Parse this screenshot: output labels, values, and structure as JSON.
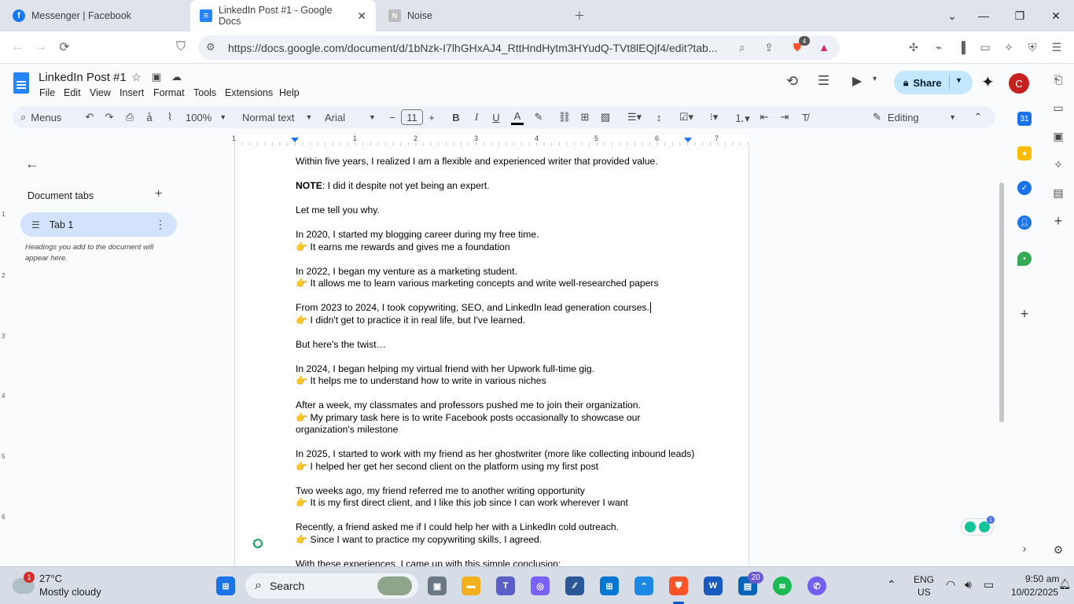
{
  "browser": {
    "tabs": [
      {
        "title": "Messenger | Facebook"
      },
      {
        "title": "LinkedIn Post #1 - Google Docs"
      },
      {
        "title": "Noise"
      }
    ],
    "url": "https://docs.google.com/document/d/1bNzk-I7lhGHxAJ4_RttHndHytm3HYudQ-TVt8lEQjf4/edit?tab...",
    "brave_badge": "4"
  },
  "docs": {
    "title": "LinkedIn Post #1",
    "menus": [
      "File",
      "Edit",
      "View",
      "Insert",
      "Format",
      "Tools",
      "Extensions",
      "Help"
    ],
    "share_label": "Share",
    "avatar_letter": "C",
    "toolbar": {
      "menus_label": "Menus",
      "zoom": "100%",
      "style": "Normal text",
      "font": "Arial",
      "font_size": "11",
      "mode": "Editing"
    },
    "ruler_marks": [
      "1",
      "1",
      "2",
      "3",
      "4",
      "5",
      "6",
      "7"
    ],
    "vruler_marks": [
      "1",
      "2",
      "3",
      "4",
      "5",
      "6"
    ],
    "sidepanel": {
      "heading": "Document tabs",
      "tab_label": "Tab 1",
      "hint": "Headings you add to the document will appear here."
    },
    "grammarly_badge": "1",
    "content": [
      {
        "lines": [
          "Within five years, I realized I am a flexible and experienced writer that provided value."
        ]
      },
      {
        "bold": "NOTE",
        "rest": ": I did it despite not yet being an expert."
      },
      {
        "lines": [
          "Let me tell you why."
        ]
      },
      {
        "lines": [
          "In 2020, I started my blogging career during my free time.",
          "👉 It earns me rewards and gives me a foundation"
        ]
      },
      {
        "lines": [
          "In 2022, I began my venture as a marketing student.",
          "👉 It allows me to learn various marketing concepts and write well-researched papers"
        ]
      },
      {
        "lines": [
          "From 2023 to 2024, I took copywriting, SEO, and LinkedIn lead generation courses.",
          "👉 I didn't get to practice it in real life, but I've learned."
        ]
      },
      {
        "lines": [
          "But here's the twist…"
        ]
      },
      {
        "lines": [
          "In 2024, I began helping my virtual friend with her Upwork full-time gig.",
          "👉 It helps me to understand how to write in various niches"
        ]
      },
      {
        "lines": [
          "After a week, my classmates and professors pushed me to join their organization.",
          "👉 My primary task here is to write Facebook posts occasionally to showcase our organization's milestone"
        ]
      },
      {
        "lines": [
          "In 2025, I started to work with my friend as her ghostwriter (more like collecting inbound leads)",
          "👉 I helped her get her second client on the platform using my first post"
        ]
      },
      {
        "lines": [
          "Two weeks ago, my friend referred me to another writing opportunity",
          "👉 It is my first direct client, and I like this job since I can work wherever I want"
        ]
      },
      {
        "lines": [
          "Recently, a friend asked me if I could help her with a LinkedIn cold outreach.",
          "👉 Since I want to practice my copywriting skills, I agreed."
        ]
      },
      {
        "lines": [
          "With these experiences, I came up with this simple conclusion:"
        ]
      }
    ]
  },
  "taskbar": {
    "weather_badge": "1",
    "temperature": "27°C",
    "weather": "Mostly cloudy",
    "search_label": "Search",
    "teams_badge": "20",
    "lang": "ENG",
    "region": "US",
    "time": "9:50 am",
    "date": "10/02/2025"
  },
  "colors": {
    "accent": "#0b57d0",
    "share_bg": "#c2e7ff",
    "avatar": "#c5221f",
    "tab_selected": "#d3e3fd"
  }
}
